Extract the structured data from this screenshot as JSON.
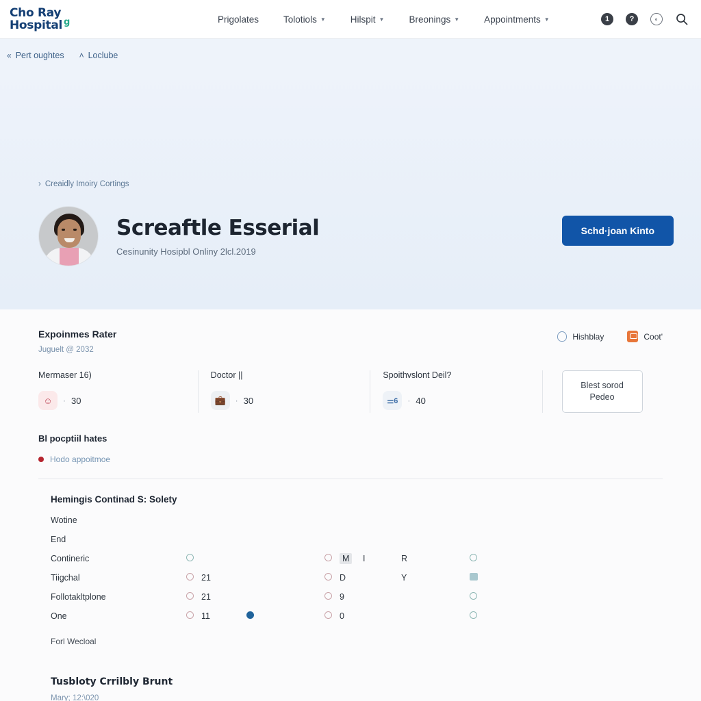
{
  "header": {
    "logo_line1": "Cho Ray",
    "logo_line2": "Hospital",
    "logo_mark": "g",
    "nav": [
      {
        "label": "Prigolates",
        "has_caret": false
      },
      {
        "label": "Tolotiols",
        "has_caret": true
      },
      {
        "label": "Hilspit",
        "has_caret": true
      },
      {
        "label": "Breonings",
        "has_caret": true
      },
      {
        "label": "Appointments",
        "has_caret": true
      }
    ],
    "icons": {
      "badge_one": "1",
      "badge_question": "?",
      "globe": "⊕",
      "search": "search-icon"
    }
  },
  "breadcrumb": {
    "items": [
      {
        "glyph": "«",
        "label": "Pert oughtes"
      },
      {
        "glyph": "˄",
        "label": "Loclube"
      }
    ]
  },
  "hero": {
    "kicker_glyph": "›",
    "kicker": "Creaidly Imoiry Cortings",
    "title": "Screaftle Esserial",
    "subtitle": "Cesinunity Hosipbl Onliny 2lcl.2019",
    "cta_label": "Schd·joan Kinto",
    "cta_color": "#1155a8",
    "background": "#eef3fa"
  },
  "stats_panel": {
    "title": "Expoinmes Rater",
    "subtitle": "Juguelt @ 2032",
    "actions": [
      {
        "label": "Hishblay",
        "icon": "ring-icon"
      },
      {
        "label": "Coot'",
        "icon": "orange-card-icon"
      }
    ],
    "cards": [
      {
        "label": "Mermaser 16)",
        "icon": "face-icon",
        "dot": "·",
        "value": "30",
        "badge_color": "#fbe9ea"
      },
      {
        "label": "Doctor ||",
        "icon": "bag-icon",
        "dot": "·",
        "value": "30",
        "badge_color": "#edf0f3"
      },
      {
        "label": "Spoithvslont Deil?",
        "icon": "tooth-icon",
        "dot": "·",
        "value": "40",
        "badge_color": "#eef2f7"
      }
    ],
    "card_icon_glyphs": {
      "face": "☺",
      "bag": "□",
      "tooth": "⑂"
    },
    "side_button": {
      "line1": "Blest sorod",
      "line2": "Pedeo"
    }
  },
  "list_section": {
    "title": "Bl pocptiil hates",
    "items": [
      {
        "label": "Hodo appoitmoe",
        "dot_color": "#b5252f"
      }
    ]
  },
  "table": {
    "title": "Hemingis Continad S: Solety",
    "pre_rows": [
      {
        "label": "Wotine"
      },
      {
        "label": "End"
      }
    ],
    "rows": [
      {
        "label": "Contineric",
        "o1": "",
        "n1": "",
        "dot": false,
        "o2": "",
        "m": "M",
        "i": "I",
        "r": "R",
        "o3": "ring",
        "o1_show": true
      },
      {
        "label": "Tiigchal",
        "o1": "",
        "n1": "21",
        "dot": false,
        "o2": "",
        "m": "D",
        "i": "",
        "r": "Y",
        "o3": "tile",
        "o1_show": true
      },
      {
        "label": "Follotakltplone",
        "o1": "",
        "n1": "21",
        "dot": false,
        "o2": "",
        "m": "9",
        "i": "",
        "r": "",
        "o3": "ring",
        "o1_show": true
      },
      {
        "label": "One",
        "o1": "",
        "n1": "11",
        "dot": true,
        "o2": "",
        "m": "0",
        "i": "",
        "r": "",
        "o3": "ring",
        "o1_show": true
      }
    ],
    "footer_label": "Forl Wecloal"
  },
  "bottom": {
    "title": "Tusbloty Crrilbly Brunt",
    "subtitle": "Mary; 12:\\020"
  }
}
